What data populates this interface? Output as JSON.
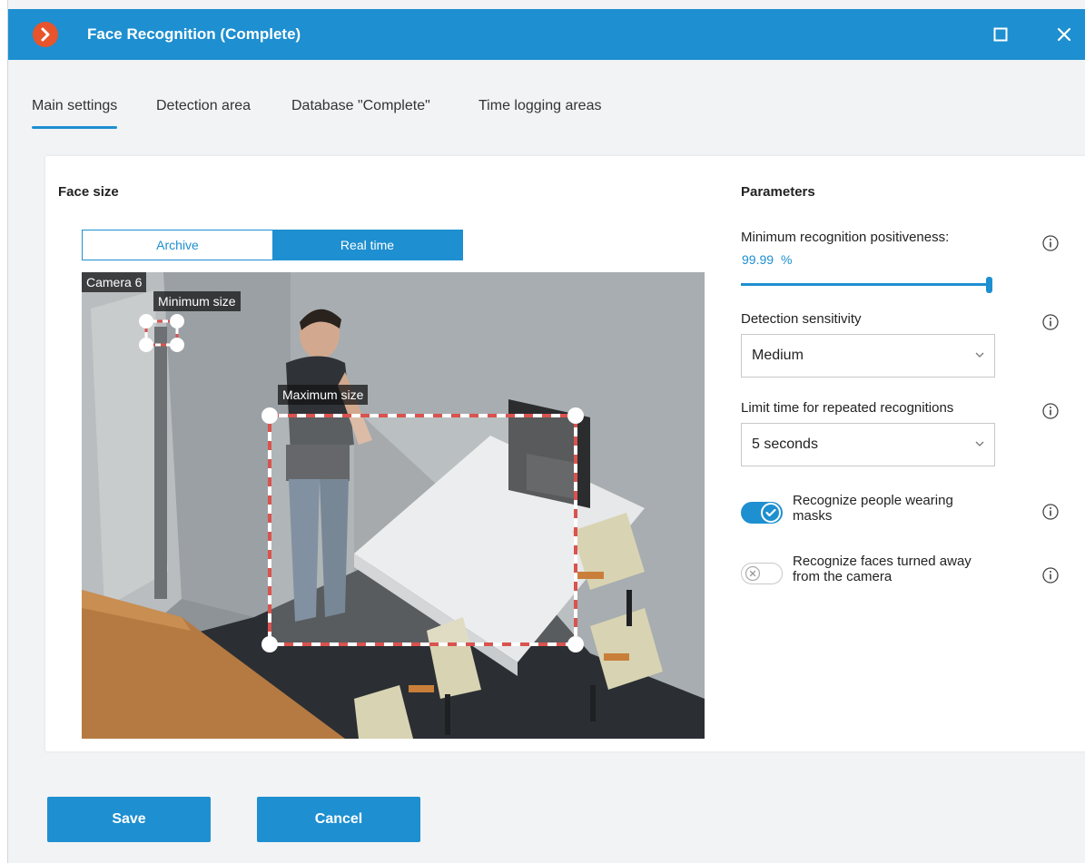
{
  "window": {
    "title": "Face Recognition (Complete)"
  },
  "tabs": [
    {
      "label": "Main settings",
      "active": true
    },
    {
      "label": "Detection area",
      "active": false
    },
    {
      "label": "Database \"Complete\"",
      "active": false
    },
    {
      "label": "Time logging areas",
      "active": false
    }
  ],
  "face_size": {
    "heading": "Face size",
    "modes": [
      {
        "label": "Archive",
        "active": false
      },
      {
        "label": "Real time",
        "active": true
      }
    ],
    "camera_name": "Camera 6",
    "min_label": "Minimum size",
    "max_label": "Maximum size"
  },
  "parameters": {
    "heading": "Parameters",
    "positiveness": {
      "label": "Minimum recognition positiveness:",
      "value": "99.99",
      "unit": "%",
      "slider_fraction": 0.9999
    },
    "sensitivity": {
      "label": "Detection sensitivity",
      "value": "Medium"
    },
    "repeat_limit": {
      "label": "Limit time for repeated recognitions",
      "value": "5 seconds"
    },
    "masks": {
      "label_line1": "Recognize people wearing",
      "label_line2": "masks",
      "enabled": true
    },
    "turned_away": {
      "label_line1": "Recognize faces turned away",
      "label_line2": "from the camera",
      "enabled": false
    }
  },
  "actions": {
    "save_label": "Save",
    "cancel_label": "Cancel"
  },
  "colors": {
    "accent": "#1e8fd0",
    "logo": "#e8542c",
    "roi_dash": "#d9534f"
  },
  "icons": {
    "logo": "chevron-right-icon",
    "maximize": "square-icon",
    "close": "close-icon",
    "info": "info-icon",
    "dropdown": "chevron-down-icon",
    "toggle_on": "check-icon",
    "toggle_off": "x-icon"
  }
}
